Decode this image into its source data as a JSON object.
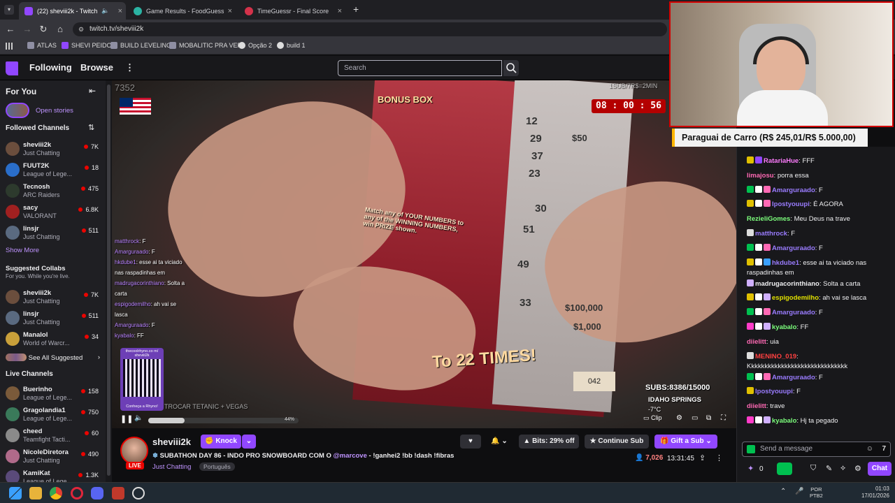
{
  "browser": {
    "tabs": [
      {
        "title": "(22) sheviii2k - Twitch",
        "active": true
      },
      {
        "title": "Game Results - FoodGuessr | Fo",
        "active": false
      },
      {
        "title": "TimeGuessr - Final Score",
        "active": false
      }
    ],
    "url": "twitch.tv/sheviii2k",
    "bookmarks": [
      "ATLAS",
      "SHEVI PEIDO",
      "BUILD LEVELING",
      "MOBALITIC PRA VER",
      "Opção 2",
      "build 1"
    ]
  },
  "twitch_nav": {
    "following": "Following",
    "browse": "Browse",
    "search_placeholder": "Search"
  },
  "sidebar": {
    "for_you": "For You",
    "open_stories": "Open stories",
    "followed_channels": "Followed Channels",
    "followed": [
      {
        "name": "sheviii2k",
        "game": "Just Chatting",
        "viewers": "7K",
        "color": "#6b4e3d"
      },
      {
        "name": "FUUT2K",
        "game": "League of Lege...",
        "viewers": "18",
        "color": "#2a6ec9"
      },
      {
        "name": "Tecnosh",
        "game": "ARC Raiders",
        "viewers": "475",
        "color": "#2d3a2d"
      },
      {
        "name": "sacy",
        "game": "VALORANT",
        "viewers": "6.8K",
        "color": "#a02020"
      },
      {
        "name": "linsjr",
        "game": "Just Chatting",
        "viewers": "511",
        "color": "#5a6a80"
      }
    ],
    "show_more": "Show More",
    "suggested_collabs": "Suggested Collabs",
    "suggested_sub": "For you. While you're live.",
    "suggested": [
      {
        "name": "sheviii2k",
        "game": "Just Chatting",
        "viewers": "7K",
        "color": "#6b4e3d"
      },
      {
        "name": "linsjr",
        "game": "Just Chatting",
        "viewers": "511",
        "color": "#5a6a80"
      },
      {
        "name": "Manalol",
        "game": "World of Warcr...",
        "viewers": "34",
        "color": "#c9a03a"
      }
    ],
    "see_all_suggested": "See All Suggested",
    "live_channels": "Live Channels",
    "live": [
      {
        "name": "Buerinho",
        "game": "League of Lege...",
        "viewers": "158",
        "color": "#7a5a3a"
      },
      {
        "name": "Gragolandia1",
        "game": "League of Lege...",
        "viewers": "750",
        "color": "#3a7a5a"
      },
      {
        "name": "cheed",
        "game": "Teamfight Tacti...",
        "viewers": "60",
        "color": "#8a8a8a"
      },
      {
        "name": "NicoleDiretora",
        "game": "Just Chatting",
        "viewers": "490",
        "color": "#b06a8a"
      },
      {
        "name": "KamiKat",
        "game": "League of Lege...",
        "viewers": "1.3K",
        "color": "#5a4a7a"
      }
    ]
  },
  "video": {
    "timer": "08 : 00 : 56",
    "top_left_count": "7352",
    "top_right_text": "1SUB/7R$=2MIN",
    "bonus_box": "BONUS BOX",
    "ticket_text": "Match any of YOUR NUMBERS to any of the WINNING NUMBERS, win PRIZE shown.",
    "ticket_bottom": "To 22 TIMES!",
    "ticket_numbers": [
      "12",
      "29",
      "37",
      "23",
      "30",
      "51",
      "49",
      "33"
    ],
    "ticket_prizes": [
      "$50",
      "$100,000",
      "$1,000"
    ],
    "ticket_code": "042",
    "subs": "SUBS:8386/15000",
    "location": "IDAHO SPRINGS",
    "temperature": "-7°C",
    "bottom_banner": "TROCAR TETANIC + VEGAS",
    "progress": "44%",
    "clip_label": "Clip",
    "qr_label": "thecoolrhyno.co m/ sheviii2k",
    "qr_caption": "Conheça a Rhyno!",
    "overlay_chat": [
      {
        "user": "matthrock",
        "text": ": F"
      },
      {
        "user": "Amarguraado",
        "text": ": F"
      },
      {
        "user": "hkdube1",
        "text": ": esse ai ta viciado"
      },
      {
        "user": "",
        "text": "nas raspadinhas em"
      },
      {
        "user": "madrugacorinthiano",
        "text": ": Solta a"
      },
      {
        "user": "",
        "text": "carta"
      },
      {
        "user": "espigodemilho",
        "text": ": ah vai se"
      },
      {
        "user": "",
        "text": "lasca"
      },
      {
        "user": "Amarguraado",
        "text": ": F"
      },
      {
        "user": "kyabalo",
        "text": ": FF"
      }
    ]
  },
  "stream_info": {
    "channel": "sheviii2k",
    "knock": "Knock",
    "live_badge": "LIVE",
    "title_start": "SUBATHON DAY 86 - INDO PRO SNOWBOARD COM O ",
    "mention": "@marcove",
    "title_end": " - !ganhei2 !bb !dash !fibras",
    "category": "Just Chatting",
    "tag": "Português",
    "bits": "Bits: 29% off",
    "continue_sub": "Continue Sub",
    "gift_sub": "Gift a Sub",
    "viewers": "7,026",
    "uptime": "13:31:45"
  },
  "goal": "Paraguai de Carro (R$ 245,01/R$ 5.000,00)",
  "chat": {
    "messages": [
      {
        "user": "RatariaHue",
        "color": "#ff7cff",
        "text": ": FFF",
        "badges": [
          "#e0c000",
          "#9147ff"
        ]
      },
      {
        "user": "limajosu",
        "color": "#ff69b4",
        "text": ": porra essa",
        "badges": []
      },
      {
        "user": "Amarguraado",
        "color": "#9a7cff",
        "text": ": F",
        "badges": [
          "#00c050",
          "#ffffff",
          "#ff69b4"
        ]
      },
      {
        "user": "lpostyouupi",
        "color": "#9a7cff",
        "text": ": É AGORA",
        "badges": [
          "#e0c000",
          "#ffffff",
          "#ff69b4"
        ]
      },
      {
        "user": "RezieliGomes",
        "color": "#7cff7c",
        "text": ": Meu Deus na trave",
        "badges": []
      },
      {
        "user": "matthrock",
        "color": "#9a7cff",
        "text": ": F",
        "badges": [
          "#dddddd"
        ]
      },
      {
        "user": "Amarguraado",
        "color": "#9a7cff",
        "text": ": F",
        "badges": [
          "#00c050",
          "#ffffff",
          "#ff69b4"
        ]
      },
      {
        "user": "hkdube1",
        "color": "#9a7cff",
        "text": ": esse ai ta viciado nas raspadinhas em",
        "badges": [
          "#e0c000",
          "#ffffff",
          "#3aa0ff"
        ]
      },
      {
        "user": "madrugacorinthiano",
        "color": "#efeff1",
        "text": ": Solta a carta",
        "badges": [
          "#d0b0ff"
        ]
      },
      {
        "user": "espigodemilho",
        "color": "#e0e000",
        "text": ": ah vai se lasca",
        "badges": [
          "#e0c000",
          "#ffffff",
          "#d0b0ff"
        ]
      },
      {
        "user": "Amarguraado",
        "color": "#9a7cff",
        "text": ": F",
        "badges": [
          "#00c050",
          "#ffffff",
          "#ff69b4"
        ]
      },
      {
        "user": "kyabalo",
        "color": "#7cff7c",
        "text": ": FF",
        "badges": [
          "#ff3cc8",
          "#ffffff",
          "#d0b0ff"
        ]
      },
      {
        "user": "diielitt",
        "color": "#ff69b4",
        "text": ": uia",
        "badges": []
      },
      {
        "user": "MENINO_019",
        "color": "#ff4040",
        "text": ": Kkkkkkkkkkkkkkkkkkkkkkkkkkkkkk",
        "badges": [
          "#dddddd"
        ]
      },
      {
        "user": "Amarguraado",
        "color": "#9a7cff",
        "text": ": F",
        "badges": [
          "#00c050",
          "#ffffff",
          "#ff69b4"
        ]
      },
      {
        "user": "lpostyouupi",
        "color": "#9a7cff",
        "text": ": F",
        "badges": [
          "#e0c000"
        ]
      },
      {
        "user": "diielitt",
        "color": "#ff69b4",
        "text": ": trave",
        "badges": []
      },
      {
        "user": "kyabalo",
        "color": "#7cff7c",
        "text": ": Hj ta pegado",
        "badges": [
          "#ff3cc8",
          "#ffffff",
          "#d0b0ff"
        ]
      }
    ],
    "input_placeholder": "Send a message",
    "points": "0",
    "chat_button": "Chat"
  },
  "taskbar": {
    "lang_top": "POR",
    "lang_bottom": "PTB2",
    "time": "01:03",
    "date": "17/01/2026"
  }
}
